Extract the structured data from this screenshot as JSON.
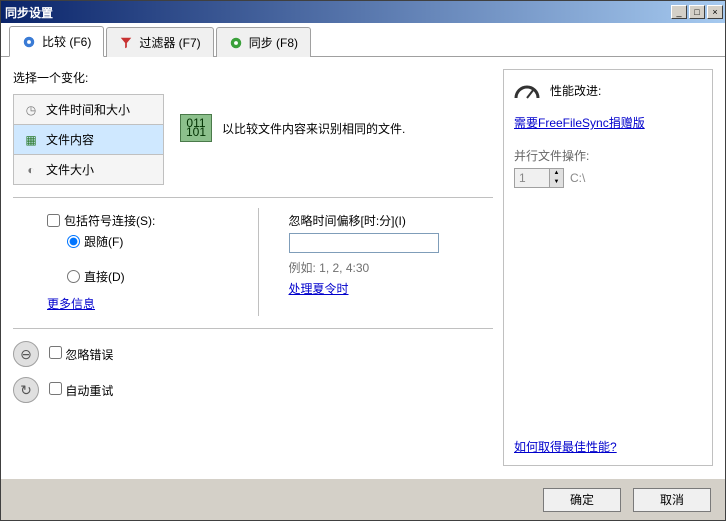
{
  "window": {
    "title": "同步设置"
  },
  "tabs": {
    "compare": "比较 (F6)",
    "filter": "过滤器 (F7)",
    "sync": "同步 (F8)"
  },
  "left": {
    "choose_label": "选择一个变化:",
    "options": {
      "time_size": "文件时间和大小",
      "content": "文件内容",
      "size": "文件大小"
    },
    "desc": "以比较文件内容来识别相同的文件.",
    "symlink": {
      "label": "包括符号连接(S):",
      "follow": "跟随(F)",
      "direct": "直接(D)"
    },
    "more_info": "更多信息",
    "offset": {
      "label": "忽略时间偏移[时:分](I)",
      "example": "例如: 1, 2, 4:30",
      "dst_link": "处理夏令时"
    },
    "ignore_errors": "忽略错误",
    "auto_retry": "自动重试"
  },
  "right": {
    "perf_title": "性能改进:",
    "donation_link": "需要FreeFileSync捐赠版",
    "parallel_label": "并行文件操作:",
    "parallel_value": "1",
    "parallel_path": "C:\\",
    "perf_link": "如何取得最佳性能?"
  },
  "footer": {
    "ok": "确定",
    "cancel": "取消"
  }
}
